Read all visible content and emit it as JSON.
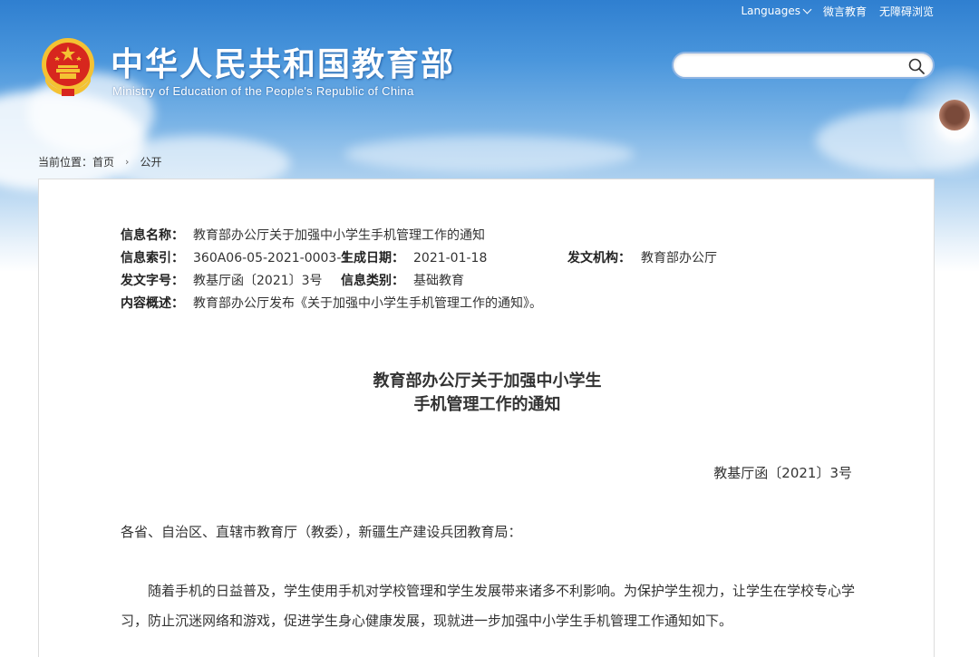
{
  "header": {
    "site_title": "中华人民共和国教育部",
    "site_subtitle": "Ministry of Education of the People's Republic of China",
    "top_links": {
      "languages": "Languages",
      "weiyan": "微言教育",
      "accessibility": "无障碍浏览"
    },
    "search": {
      "value": "",
      "icon": "search-icon"
    }
  },
  "breadcrumb": {
    "prefix": "当前位置：",
    "home": "首页",
    "current": "公开"
  },
  "meta": {
    "name_label": "信息名称：",
    "name_value": "教育部办公厅关于加强中小学生手机管理工作的通知",
    "index_label": "信息索引：",
    "index_value": "360A06-05-2021-0003-1",
    "date_label": "生成日期：",
    "date_value": "2021-01-18",
    "org_label": "发文机构：",
    "org_value": "教育部办公厅",
    "docno_label": "发文字号：",
    "docno_value": "教基厅函〔2021〕3号",
    "category_label": "信息类别：",
    "category_value": "基础教育",
    "summary_label": "内容概述：",
    "summary_value": "教育部办公厅发布《关于加强中小学生手机管理工作的通知》。"
  },
  "document": {
    "title_line1": "教育部办公厅关于加强中小学生",
    "title_line2": "手机管理工作的通知",
    "number": "教基厅函〔2021〕3号",
    "greeting": "各省、自治区、直辖市教育厅（教委），新疆生产建设兵团教育局：",
    "paragraph1": "随着手机的日益普及，学生使用手机对学校管理和学生发展带来诸多不利影响。为保护学生视力，让学生在学校专心学习，防止沉迷网络和游戏，促进学生身心健康发展，现就进一步加强中小学生手机管理工作通知如下。"
  },
  "colors": {
    "sky_top": "#2f7fd0",
    "emblem_red": "#d7261e",
    "emblem_gold": "#f4c233",
    "search_border": "#8db4e3"
  }
}
